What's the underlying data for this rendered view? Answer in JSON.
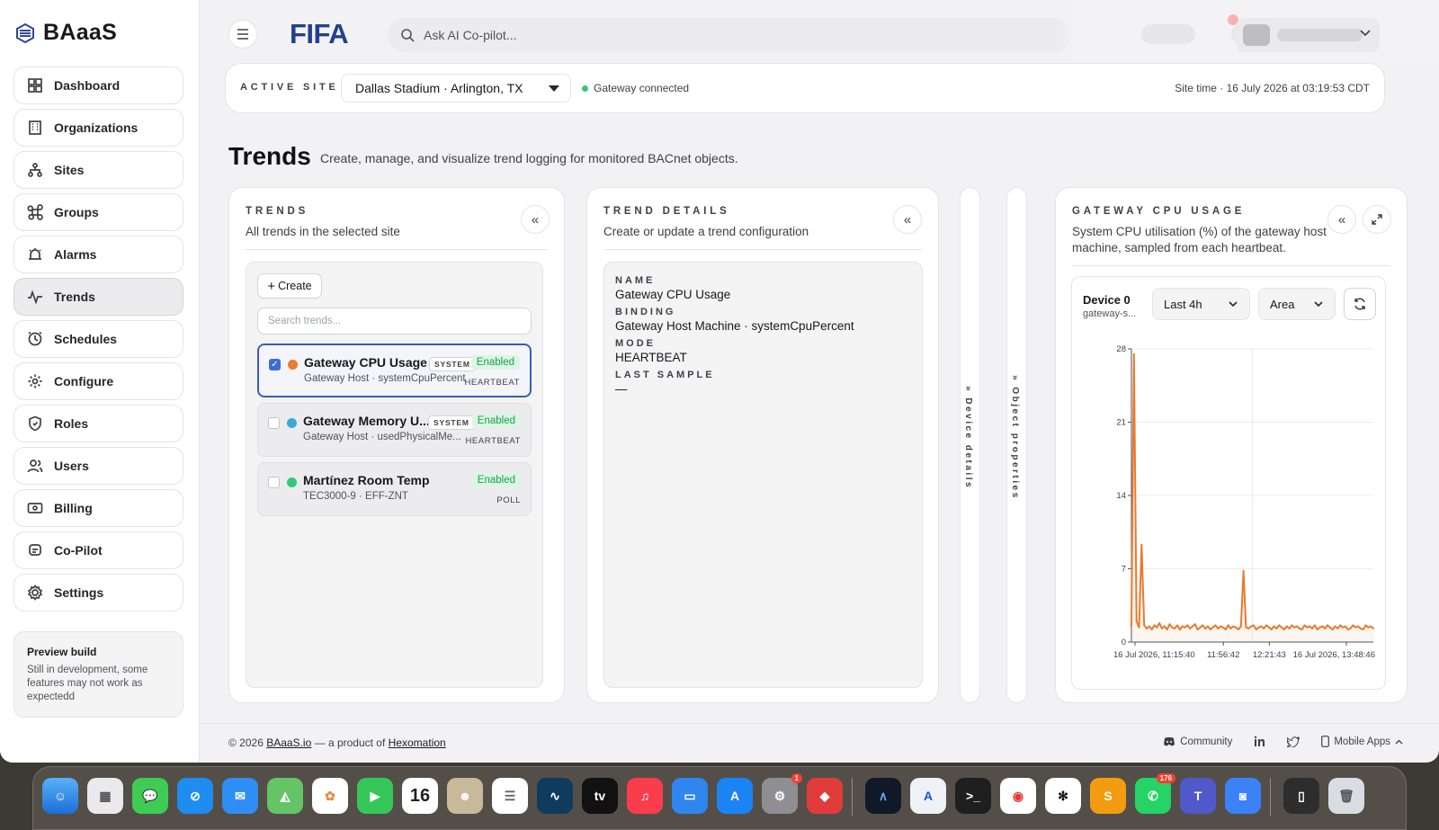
{
  "app": {
    "brand": "BAaaS"
  },
  "sidebar": {
    "items": [
      {
        "label": "Dashboard",
        "icon": "grid-icon"
      },
      {
        "label": "Organizations",
        "icon": "building-icon"
      },
      {
        "label": "Sites",
        "icon": "sitemap-icon"
      },
      {
        "label": "Groups",
        "icon": "command-icon"
      },
      {
        "label": "Alarms",
        "icon": "alarm-icon"
      },
      {
        "label": "Trends",
        "icon": "trend-icon",
        "active": true
      },
      {
        "label": "Schedules",
        "icon": "clock-icon"
      },
      {
        "label": "Configure",
        "icon": "gear-icon"
      },
      {
        "label": "Roles",
        "icon": "shield-icon"
      },
      {
        "label": "Users",
        "icon": "users-icon"
      },
      {
        "label": "Billing",
        "icon": "billing-icon"
      },
      {
        "label": "Co-Pilot",
        "icon": "copilot-icon"
      },
      {
        "label": "Settings",
        "icon": "settings-icon"
      }
    ],
    "preview": {
      "title": "Preview build",
      "text": "Still in development, some features may not work as expectedd"
    }
  },
  "header": {
    "logo": "FIFA",
    "search_placeholder": "Ask AI Co-pilot..."
  },
  "site_bar": {
    "label": "ACTIVE SITE",
    "selected_site": "Dallas Stadium · Arlington, TX",
    "gateway_status": "Gateway connected",
    "site_time": "Site time · 16 July 2026 at 03:19:53 CDT"
  },
  "page": {
    "title": "Trends",
    "subtitle": "Create, manage, and visualize trend logging for monitored BACnet objects."
  },
  "trends_panel": {
    "title": "TRENDS",
    "subtitle": "All trends in the selected site",
    "create_label": "Create",
    "search_placeholder": "Search trends...",
    "rows": [
      {
        "name": "Gateway CPU Usage",
        "system": "SYSTEM",
        "status": "Enabled",
        "binding": "Gateway Host · systemCpuPercent",
        "mode": "HEARTBEAT",
        "color": "#ea7a2e",
        "selected": true
      },
      {
        "name": "Gateway Memory U...",
        "system": "SYSTEM",
        "status": "Enabled",
        "binding": "Gateway Host · usedPhysicalMe...",
        "mode": "HEARTBEAT",
        "color": "#3aa9d6",
        "selected": false
      },
      {
        "name": "Martínez Room Temp",
        "system": "",
        "status": "Enabled",
        "binding": "TEC3000-9 · EFF-ZNT",
        "mode": "POLL",
        "color": "#34c77b",
        "selected": false
      }
    ]
  },
  "details_panel": {
    "title": "TREND DETAILS",
    "subtitle": "Create or update a trend configuration",
    "fields": [
      {
        "label": "NAME",
        "value": "Gateway CPU Usage"
      },
      {
        "label": "BINDING",
        "value": "Gateway Host Machine · systemCpuPercent"
      },
      {
        "label": "MODE",
        "value": "HEARTBEAT"
      },
      {
        "label": "LAST SAMPLE",
        "value": "—"
      }
    ]
  },
  "side_tabs": {
    "device": "Device details",
    "object": "Object properties"
  },
  "cpu_panel": {
    "title": "GATEWAY CPU USAGE",
    "subtitle": "System CPU utilisation (%) of the gateway host machine, sampled from each heartbeat.",
    "device_name": "Device 0",
    "device_sub": "gateway-s...",
    "range": "Last 4h",
    "chart_type": "Area"
  },
  "chart_data": {
    "type": "line",
    "ylim": [
      0,
      28
    ],
    "yticks": [
      0,
      7,
      14,
      21,
      28
    ],
    "xticks": [
      "16 Jul 2026, 11:15:40",
      "11:56:42",
      "12:21:43",
      "16 Jul 2026, 13:48:46"
    ],
    "color": "#ea7a2e",
    "series": [
      {
        "values": [
          1.5,
          27.5,
          2.0,
          1.4,
          9.3,
          1.6,
          1.3,
          1.5,
          1.2,
          1.6,
          1.4,
          1.8,
          1.3,
          1.5,
          1.2,
          1.7,
          1.4,
          1.3,
          1.6,
          1.2,
          1.5,
          1.4,
          1.6,
          1.3,
          1.5,
          1.7,
          1.2,
          1.4,
          1.6,
          1.3,
          1.5,
          1.2,
          1.4,
          1.6,
          1.3,
          1.5,
          1.4,
          1.2,
          1.6,
          1.3,
          1.5,
          1.4,
          1.2,
          1.5,
          6.8,
          1.4,
          1.3,
          1.5,
          1.6,
          1.2,
          1.4,
          1.5,
          1.3,
          1.6,
          1.4,
          1.2,
          1.5,
          1.3,
          1.6,
          1.4,
          1.2,
          1.5,
          1.3,
          1.6,
          1.4,
          1.5,
          1.3,
          1.2,
          1.6,
          1.4,
          1.5,
          1.3,
          1.6,
          1.2,
          1.4,
          1.5,
          1.3,
          1.6,
          1.4,
          1.2,
          1.5,
          1.3,
          1.6,
          1.4,
          1.5,
          1.2,
          1.3,
          1.6,
          1.4,
          1.5,
          1.3,
          1.2,
          1.6,
          1.4,
          1.5,
          1.3
        ]
      }
    ]
  },
  "footer": {
    "copyright": "© 2026",
    "brand_link": "BAaaS.io",
    "middle": "— a product of",
    "company_link": "Hexomation",
    "community": "Community",
    "mobile_apps": "Mobile Apps"
  },
  "dock": {
    "calendar_day": "16",
    "settings_badge": "1",
    "whatsapp_badge": "176"
  }
}
